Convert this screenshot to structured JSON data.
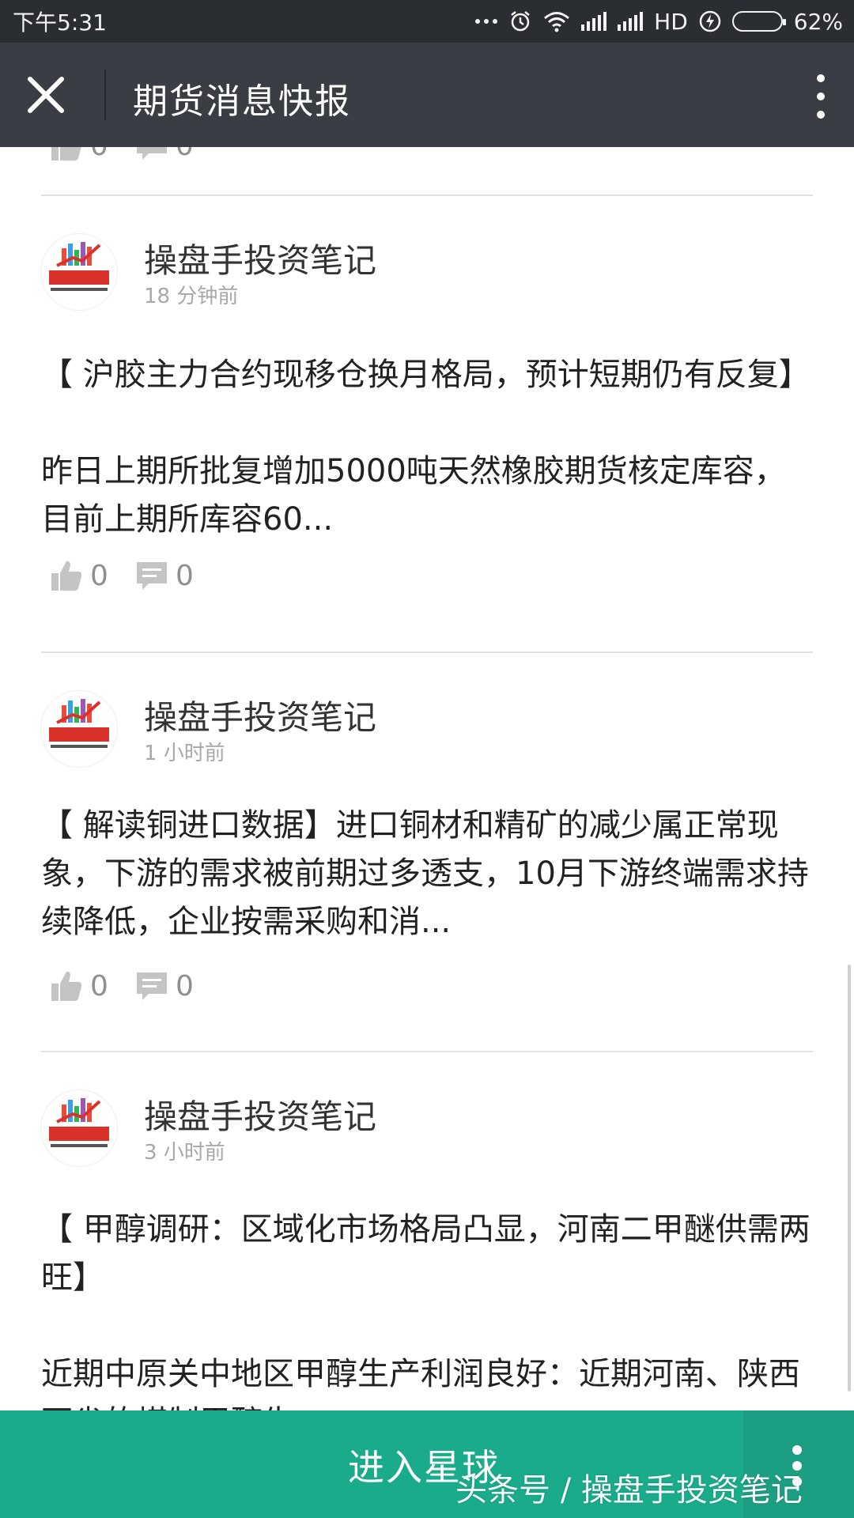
{
  "status_bar": {
    "time": "下午5:31",
    "network": "HD",
    "battery": "62%",
    "battery_level": 0.62
  },
  "header": {
    "title": "期货消息快报",
    "close_icon": "close-icon",
    "more_icon": "more-vertical-icon"
  },
  "partial_post": {
    "like_count": "0",
    "comment_count": "0"
  },
  "posts": [
    {
      "author": "操盘手投资笔记",
      "time": "18 分钟前",
      "headline": "【 沪胶主力合约现移仓换月格局，预计短期仍有反复】",
      "excerpt": "昨日上期所批复增加5000吨天然橡胶期货核定库容，目前上期所库容60...",
      "like_count": "0",
      "comment_count": "0"
    },
    {
      "author": "操盘手投资笔记",
      "time": "1 小时前",
      "headline": "【 解读铜进口数据】进口铜材和精矿的减少属正常现象，下游的需求被前期过多透支，10月下游终端需求持续降低，企业按需采购和消...",
      "excerpt": "",
      "like_count": "0",
      "comment_count": "0"
    },
    {
      "author": "操盘手投资笔记",
      "time": "3 小时前",
      "headline": "【 甲醇调研：区域化市场格局凸显，河南二甲醚供需两旺】",
      "excerpt": "近期中原关中地区甲醇生产利润良好：近期河南、陕西两省的煤制甲醇生...",
      "like_count": "",
      "comment_count": ""
    }
  ],
  "bottom_bar": {
    "enter_label": "进入星球",
    "watermark": "头条号 / 操盘手投资笔记"
  },
  "colors": {
    "status_bg": "#2a2d31",
    "header_bg": "#3a3d43",
    "accent_green": "#1aab8b",
    "avatar_red": "#d8322b"
  }
}
